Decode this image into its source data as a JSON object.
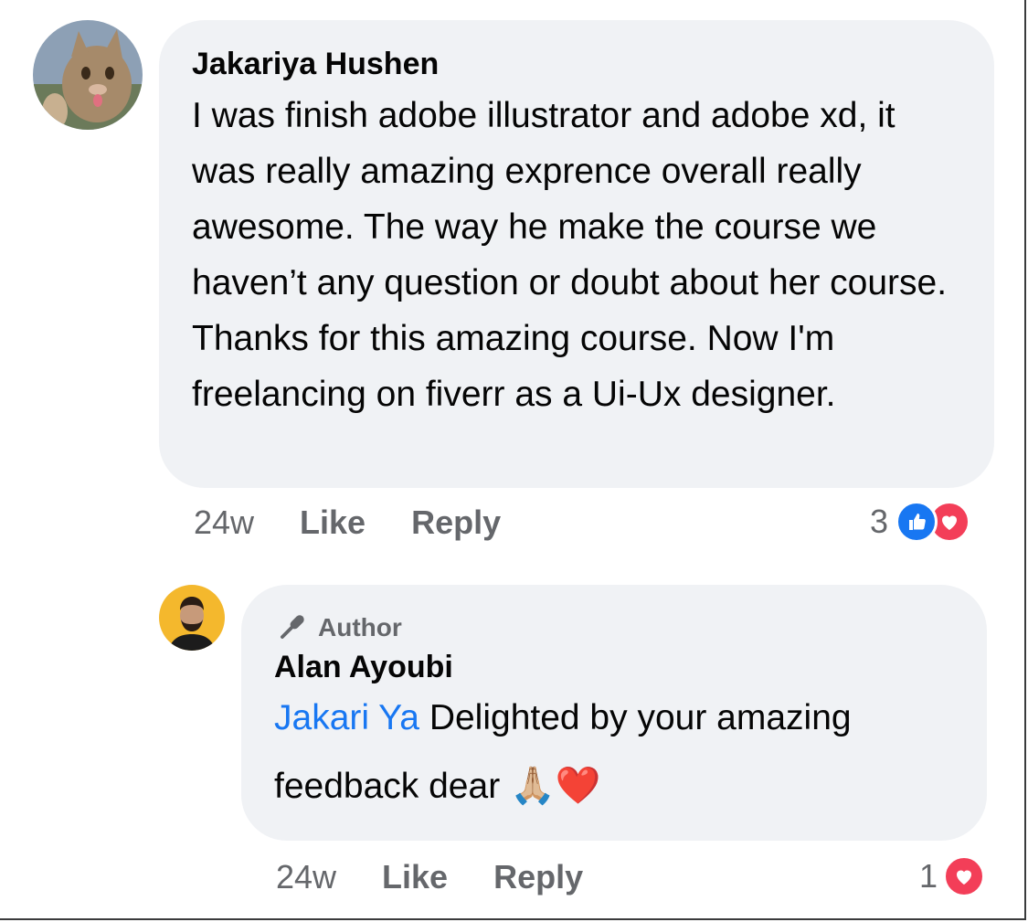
{
  "comments": [
    {
      "author": "Jakariya Hushen",
      "text": "I was finish adobe illustrator and adobe xd, it was really amazing exprence overall really awesome. The way he make the course we haven’t any question or doubt about her course. Thanks for this amazing course. Now I'm freelancing on fiverr as a Ui-Ux designer.",
      "time": "24w",
      "like_label": "Like",
      "reply_label": "Reply",
      "reaction_count": "3",
      "reactions": [
        "like-reaction-icon",
        "love-reaction-icon"
      ]
    }
  ],
  "reply": {
    "badge": "Author",
    "author": "Alan Ayoubi",
    "mention": "Jakari Ya",
    "text": " Delighted by your amazing feedback dear",
    "emoji": [
      "🙏🏼",
      "❤️"
    ],
    "time": "24w",
    "like_label": "Like",
    "reply_label": "Reply",
    "reaction_count": "1",
    "reactions": [
      "love-reaction-icon"
    ]
  },
  "colors": {
    "bubble": "#f0f2f5",
    "mention": "#1877f2",
    "meta": "#65676b",
    "like": "#1877f2",
    "love": "#f33e58"
  }
}
